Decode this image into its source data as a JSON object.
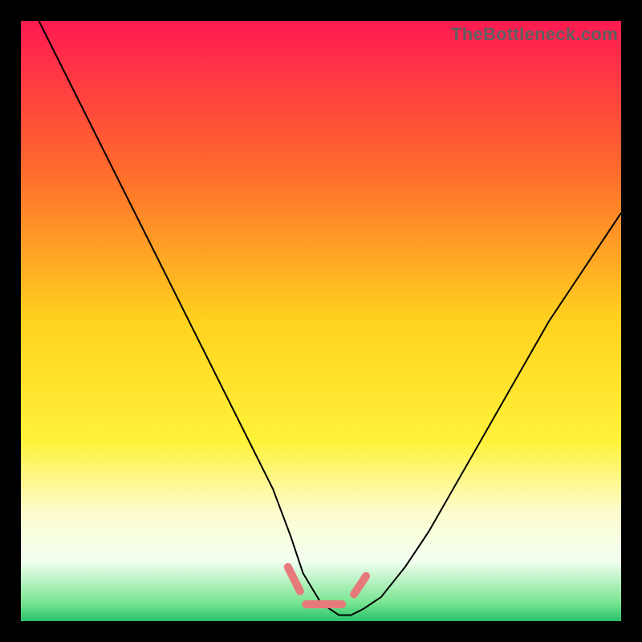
{
  "watermark": "TheBottleneck.com",
  "chart_data": {
    "type": "line",
    "title": "",
    "xlabel": "",
    "ylabel": "",
    "xlim": [
      0,
      100
    ],
    "ylim": [
      0,
      100
    ],
    "background_gradient": {
      "stops": [
        {
          "offset": 0.0,
          "color": "#ff1a52"
        },
        {
          "offset": 0.25,
          "color": "#ff6b2b"
        },
        {
          "offset": 0.5,
          "color": "#ffd21f"
        },
        {
          "offset": 0.7,
          "color": "#fff23a"
        },
        {
          "offset": 0.82,
          "color": "#fdfccf"
        },
        {
          "offset": 0.9,
          "color": "#f2fff0"
        },
        {
          "offset": 0.97,
          "color": "#77e48f"
        },
        {
          "offset": 1.0,
          "color": "#27c36a"
        }
      ]
    },
    "series": [
      {
        "name": "bottleneck-curve",
        "stroke": "#000000",
        "stroke_width": 2,
        "x": [
          3,
          6,
          10,
          14,
          18,
          22,
          26,
          30,
          34,
          38,
          42,
          45,
          47,
          50,
          53,
          55,
          57,
          60,
          64,
          68,
          72,
          76,
          80,
          84,
          88,
          92,
          96,
          100
        ],
        "y": [
          100,
          94,
          86,
          78,
          70,
          62,
          54,
          46,
          38,
          30,
          22,
          14,
          8,
          3,
          1,
          1,
          2,
          4,
          9,
          15,
          22,
          29,
          36,
          43,
          50,
          56,
          62,
          68
        ]
      },
      {
        "name": "bottom-marker",
        "type": "marker-band",
        "stroke": "#e67a7a",
        "stroke_width": 10,
        "linecap": "round",
        "segments": [
          {
            "x": [
              44.5,
              46.5
            ],
            "y": [
              9.0,
              5.0
            ]
          },
          {
            "x": [
              47.5,
              53.5
            ],
            "y": [
              2.8,
              2.8
            ]
          },
          {
            "x": [
              55.5,
              57.5
            ],
            "y": [
              4.5,
              7.5
            ]
          }
        ]
      }
    ]
  }
}
